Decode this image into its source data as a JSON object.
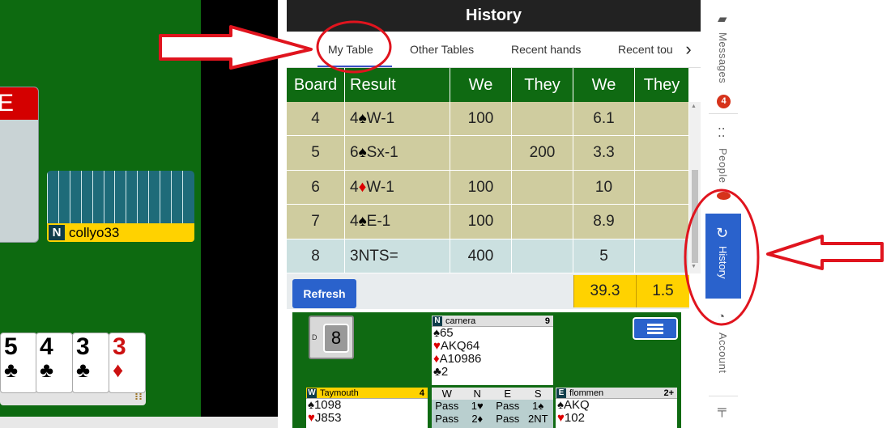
{
  "game": {
    "red_box_letter": "E",
    "player": {
      "seat": "N",
      "name": "collyo33"
    },
    "hand_cards": [
      {
        "rank": "5",
        "suit": "♣",
        "color": "black"
      },
      {
        "rank": "4",
        "suit": "♣",
        "color": "black"
      },
      {
        "rank": "3",
        "suit": "♣",
        "color": "black"
      },
      {
        "rank": "3",
        "suit": "♦",
        "color": "red"
      }
    ],
    "tray_icon": "bid-hand-icon"
  },
  "history": {
    "title": "History",
    "tabs": [
      "My Table",
      "Other Tables",
      "Recent hands",
      "Recent tou"
    ],
    "active_tab": "My Table",
    "columns": [
      "Board",
      "Result",
      "We",
      "They",
      "We",
      "They"
    ],
    "rows": [
      {
        "board": "4",
        "result_level": "4",
        "result_suit": "♠",
        "result_rest": "W-1",
        "we": "100",
        "they": "",
        "we2": "6.1",
        "they2": ""
      },
      {
        "board": "5",
        "result_level": "6",
        "result_suit": "♠",
        "result_rest": "Sx-1",
        "we": "",
        "they": "200",
        "we2": "3.3",
        "they2": ""
      },
      {
        "board": "6",
        "result_level": "4",
        "result_suit": "♦",
        "result_rest": "W-1",
        "we": "100",
        "they": "",
        "we2": "10",
        "they2": ""
      },
      {
        "board": "7",
        "result_level": "4",
        "result_suit": "♠",
        "result_rest": "E-1",
        "we": "100",
        "they": "",
        "we2": "8.9",
        "they2": ""
      },
      {
        "board": "8",
        "result_level": "3NTS=",
        "result_suit": "",
        "result_rest": "",
        "we": "400",
        "they": "",
        "we2": "5",
        "they2": ""
      }
    ],
    "refresh_label": "Refresh",
    "totals": {
      "we": "39.3",
      "they": "1.5"
    },
    "deal": {
      "board_number": "8",
      "dealer_letter": "D",
      "north": {
        "seat": "N",
        "name": "carnera",
        "hcp": "9",
        "spades": "65",
        "hearts": "AKQ64",
        "diamonds": "A10986",
        "clubs": "2"
      },
      "west": {
        "seat": "W",
        "name": "Taymouth",
        "hcp": "4",
        "spades": "1098",
        "hearts": "J853"
      },
      "east": {
        "seat": "E",
        "name": "flommen",
        "hcp": "2+",
        "spades": "AKQ",
        "hearts": "102"
      },
      "auction_header": [
        "W",
        "N",
        "E",
        "S"
      ],
      "auction_rows": [
        [
          "Pass",
          "1♥",
          "Pass",
          "1♠"
        ],
        [
          "Pass",
          "2♦",
          "Pass",
          "2NT"
        ]
      ]
    }
  },
  "sidebar": {
    "messages": {
      "label": "Messages",
      "badge": "4"
    },
    "people": {
      "label": "People"
    },
    "history": {
      "label": "History"
    },
    "account": {
      "label": "Account"
    }
  },
  "colors": {
    "felt": "#0d6a10",
    "accent_blue": "#2a62cc",
    "total_yellow": "#ffd200",
    "annotation_red": "#e0141e"
  }
}
